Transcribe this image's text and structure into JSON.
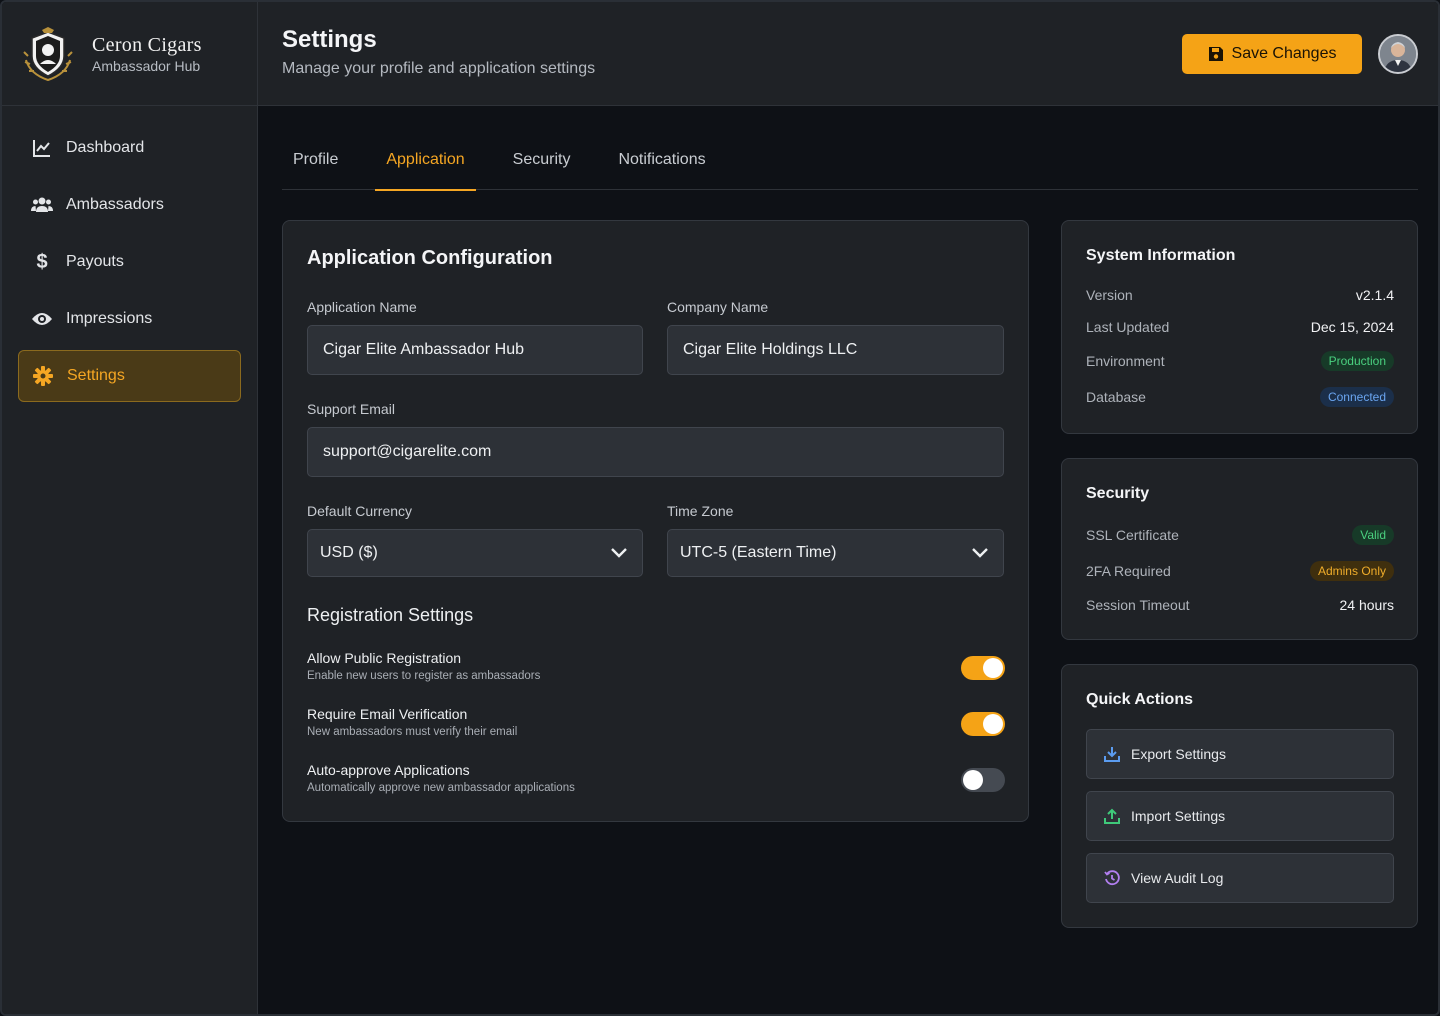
{
  "brand": {
    "name": "Ceron Cigars",
    "subtitle": "Ambassador Hub"
  },
  "sidebar": {
    "items": [
      {
        "label": "Dashboard",
        "icon": "chart-line-icon"
      },
      {
        "label": "Ambassadors",
        "icon": "users-icon"
      },
      {
        "label": "Payouts",
        "icon": "dollar-icon"
      },
      {
        "label": "Impressions",
        "icon": "eye-icon"
      },
      {
        "label": "Settings",
        "icon": "gear-icon",
        "active": true
      }
    ]
  },
  "header": {
    "title": "Settings",
    "subtitle": "Manage your profile and application settings",
    "save_label": "Save Changes"
  },
  "tabs": [
    {
      "label": "Profile"
    },
    {
      "label": "Application",
      "active": true
    },
    {
      "label": "Security"
    },
    {
      "label": "Notifications"
    }
  ],
  "config": {
    "title": "Application Configuration",
    "app_name_label": "Application Name",
    "app_name_value": "Cigar Elite Ambassador Hub",
    "company_label": "Company Name",
    "company_value": "Cigar Elite Holdings LLC",
    "email_label": "Support Email",
    "email_value": "support@cigarelite.com",
    "currency_label": "Default Currency",
    "currency_value": "USD ($)",
    "timezone_label": "Time Zone",
    "timezone_value": "UTC-5 (Eastern Time)",
    "registration_title": "Registration Settings",
    "toggles": [
      {
        "title": "Allow Public Registration",
        "desc": "Enable new users to register as ambassadors",
        "on": true
      },
      {
        "title": "Require Email Verification",
        "desc": "New ambassadors must verify their email",
        "on": true
      },
      {
        "title": "Auto-approve Applications",
        "desc": "Automatically approve new ambassador applications",
        "on": false
      }
    ]
  },
  "system_info": {
    "title": "System Information",
    "version_label": "Version",
    "version_value": "v2.1.4",
    "updated_label": "Last Updated",
    "updated_value": "Dec 15, 2024",
    "env_label": "Environment",
    "env_value": "Production",
    "db_label": "Database",
    "db_value": "Connected"
  },
  "security": {
    "title": "Security",
    "ssl_label": "SSL Certificate",
    "ssl_value": "Valid",
    "twofa_label": "2FA Required",
    "twofa_value": "Admins Only",
    "session_label": "Session Timeout",
    "session_value": "24 hours"
  },
  "quick_actions": {
    "title": "Quick Actions",
    "export_label": "Export Settings",
    "import_label": "Import Settings",
    "audit_label": "View Audit Log"
  },
  "colors": {
    "accent": "#f5a316",
    "sidebar_bg": "#1f2226",
    "page_bg": "#0e1116"
  }
}
